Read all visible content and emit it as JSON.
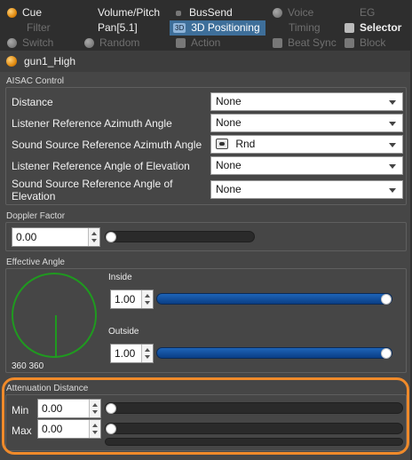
{
  "tabs": {
    "row1": [
      {
        "label": "Cue",
        "icon": "orange-circle-icon",
        "state": "active"
      },
      {
        "label": "Volume/Pitch",
        "icon": "",
        "state": "active"
      },
      {
        "label": "BusSend",
        "icon": "small-square-icon",
        "state": "active"
      },
      {
        "label": "Voice",
        "icon": "grey-circle-icon",
        "state": "disabled"
      },
      {
        "label": "EG",
        "icon": "",
        "state": "disabled"
      }
    ],
    "row2": [
      {
        "label": "Filter",
        "icon": "",
        "state": "disabled"
      },
      {
        "label": "Pan[5.1]",
        "icon": "",
        "state": "active"
      },
      {
        "label": "3D Positioning",
        "icon": "3d-icon",
        "state": "selected"
      },
      {
        "label": "Timing",
        "icon": "",
        "state": "disabled"
      },
      {
        "label": "Selector",
        "icon": "selector-icon",
        "state": "active"
      }
    ],
    "row3": [
      {
        "label": "Switch",
        "icon": "switch-icon",
        "state": "disabled"
      },
      {
        "label": "Random",
        "icon": "random-icon",
        "state": "disabled"
      },
      {
        "label": "Action",
        "icon": "action-icon",
        "state": "disabled"
      },
      {
        "label": "Beat Sync",
        "icon": "beat-sync-icon",
        "state": "disabled"
      },
      {
        "label": "Block",
        "icon": "block-icon",
        "state": "disabled"
      }
    ]
  },
  "object_name": "gun1_High",
  "aisac": {
    "title": "AISAC Control",
    "rows": [
      {
        "label": "Distance",
        "value": "None"
      },
      {
        "label": "Listener Reference Azimuth Angle",
        "value": "None"
      },
      {
        "label": "Sound Source Reference Azimuth Angle",
        "value": "Rnd"
      },
      {
        "label": "Listener Reference Angle of Elevation",
        "value": "None"
      },
      {
        "label": "Sound Source Reference Angle of Elevation",
        "value": "None"
      }
    ]
  },
  "doppler": {
    "title": "Doppler Factor",
    "value": "0.00",
    "level": 0.0
  },
  "effective_angle": {
    "title": "Effective Angle",
    "inside_label": "Inside",
    "inside_value": "1.00",
    "inside_level": 1.0,
    "outside_label": "Outside",
    "outside_value": "1.00",
    "outside_level": 1.0,
    "angles_text": "360 360"
  },
  "attenuation": {
    "title": "Attenuation Distance",
    "min_label": "Min",
    "min_value": "0.00",
    "min_level": 0.0,
    "max_label": "Max",
    "max_value": "0.00",
    "max_level": 0.0
  },
  "colors": {
    "accent": "#3e6f9a",
    "highlight": "#f08a2a",
    "angle_ring": "#1f9a1f",
    "fill": "#1e64b8"
  }
}
